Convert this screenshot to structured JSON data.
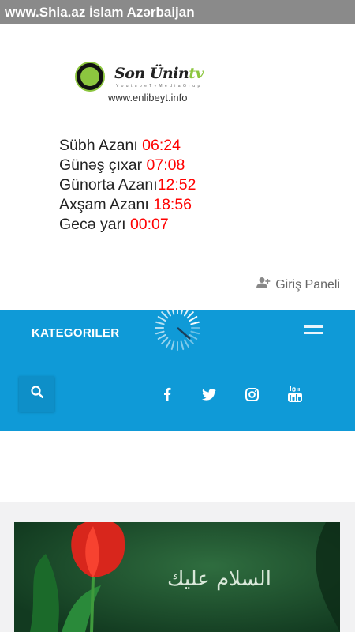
{
  "window": {
    "title": "www.Shia.az İslam Azərbaijan"
  },
  "logo": {
    "brand_main": "Son Ünin",
    "brand_tv": "tv",
    "tagline": "Y o u t u b e  T v  M e d i a  G r u p",
    "url": "www.enlibeyt.info",
    "badge_text": "Son Ünin tv"
  },
  "prayer_times": [
    {
      "label": "Sübh Azanı ",
      "time": "06:24"
    },
    {
      "label": "Günəş çıxar ",
      "time": "07:08"
    },
    {
      "label": "Günorta Azanı",
      "time": "12:52"
    },
    {
      "label": "Axşam Azanı ",
      "time": "18:56"
    },
    {
      "label": "Gecə yarı ",
      "time": "00:07"
    }
  ],
  "login": {
    "label": "Giriş Paneli"
  },
  "nav": {
    "categories_label": "KATEGORILER"
  },
  "icons": {
    "loader": "loading-spinner-icon",
    "menu": "hamburger-menu-icon",
    "search": "search-icon",
    "facebook": "facebook-icon",
    "twitter": "twitter-icon",
    "instagram": "instagram-icon",
    "youtube": "youtube-icon",
    "user": "user-add-icon"
  },
  "colors": {
    "accent": "#0f9ad7",
    "time_red": "#ff0000",
    "titlebar": "#8a8a8a",
    "logo_green": "#8cc63f"
  },
  "featured_image": {
    "description_text": "السلام عليك"
  }
}
